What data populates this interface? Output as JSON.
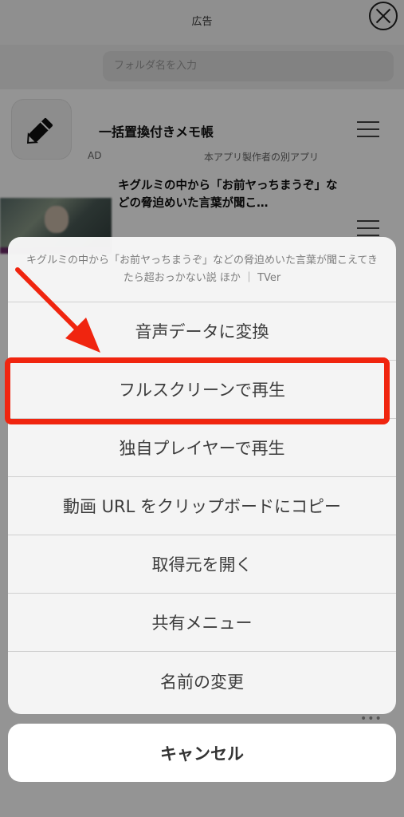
{
  "page": {
    "ad_label": "広告",
    "search_placeholder": "フォルダ名を入力",
    "ad_item": {
      "title": "一括置換付きメモ帳",
      "tag": "AD",
      "note": "本アプリ製作者の別アプリ",
      "icon": "pencil-icon"
    },
    "video_item": {
      "title": "キグルミの中から「お前ヤっちまうぞ」などの脅迫めいた言葉が聞こ…"
    }
  },
  "action_sheet": {
    "header": "キグルミの中から「お前ヤっちまうぞ」などの脅迫めいた言葉が聞こえてきたら超おっかない説 ほか ｜ TVer",
    "items": [
      {
        "label": "音声データに変換"
      },
      {
        "label": "フルスクリーンで再生"
      },
      {
        "label": "独自プレイヤーで再生"
      },
      {
        "label": "動画 URL をクリップボードにコピー"
      },
      {
        "label": "取得元を開く"
      },
      {
        "label": "共有メニュー"
      },
      {
        "label": "名前の変更"
      }
    ],
    "cancel_label": "キャンセル"
  },
  "annotation": {
    "highlight_color": "#f0250f",
    "highlighted_item": "フルスクリーンで再生"
  }
}
